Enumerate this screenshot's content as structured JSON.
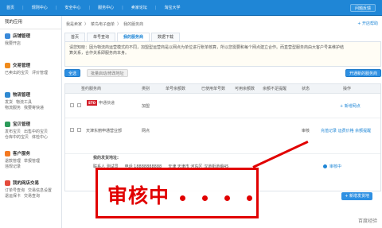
{
  "top_nav": [
    "首页",
    "|",
    "规则中心",
    "|",
    "安全中心",
    "|",
    "服务中心",
    "|",
    "卖家论坛",
    "|",
    "淘宝大学"
  ],
  "help_button": "问题反馈",
  "sidebar": {
    "title": "我的应用",
    "groups": [
      {
        "name": "店铺管理",
        "items": [
          "我要开店"
        ],
        "color": "#3a89d9"
      },
      {
        "name": "交易管理",
        "items": [
          "已卖出的宝贝",
          "评价管理"
        ],
        "color": "#f08b1b"
      },
      {
        "name": "物流管理",
        "items": [
          "发货",
          "物流工具",
          "物流服务",
          "我要寄快递"
        ],
        "color": "#2f89d1"
      },
      {
        "name": "宝贝管理",
        "items": [
          "发布宝贝",
          "出售中的宝贝",
          "仓库中的宝贝",
          "体检中心"
        ],
        "color": "#2b9a59"
      },
      {
        "name": "客户服务",
        "items": [
          "退款管理",
          "举报管理",
          "违规记录"
        ],
        "color": "#f47920"
      },
      {
        "name": "我的网店交易",
        "items": [
          "订单号查询",
          "交易信息设置",
          "退运保卡",
          "交易查询"
        ],
        "color": "#e44b3c"
      }
    ]
  },
  "breadcrumb": [
    "我是卖家",
    "〉",
    "菜鸟电子面单",
    "〉",
    "我的服务商"
  ],
  "new_link": "+ 开店帮助",
  "tabs": [
    {
      "label": "首页",
      "active": false
    },
    {
      "label": "单号查询",
      "active": false
    },
    {
      "label": "我的服务商",
      "active": true
    },
    {
      "label": "数据下载",
      "active": false
    }
  ],
  "notice": {
    "line1": "请您知晓：因为物流商运营模式的不同，加盟型运营商是以网点为单位进行账单核算，所以您需要和每个网点建立合作。而直营型服务商由大客户号来维护结",
    "line2": "算关系，合作关系即服务商本身。"
  },
  "toolbar": {
    "btn1": "全选",
    "btn2": "批量启动/修改地址",
    "btn3": "开通新的服务商"
  },
  "table": {
    "headers": [
      "签约服务商",
      "类别",
      "单号余额数",
      "已使用单号数",
      "可用余额数",
      "余额不足提醒",
      "状态",
      "操作"
    ],
    "rows": [
      {
        "name": "申通快递",
        "type": "加盟",
        "status": "",
        "op": "+ 新增网点"
      },
      {
        "name": "天津东丽申通营业部",
        "type": "网点",
        "status": "审核",
        "op": "充值记录 运费价格 余额提醒"
      }
    ],
    "address_label": "我的发货地址:",
    "contact_name": "联系人 测试员",
    "phone": "电话 18888888888",
    "address": "天津 天津市 河东区 汉道街道缉45",
    "review_status": "审核中",
    "add_button": "+ 新增发货地"
  },
  "annotation": "审核中",
  "watermark": "百度经验"
}
